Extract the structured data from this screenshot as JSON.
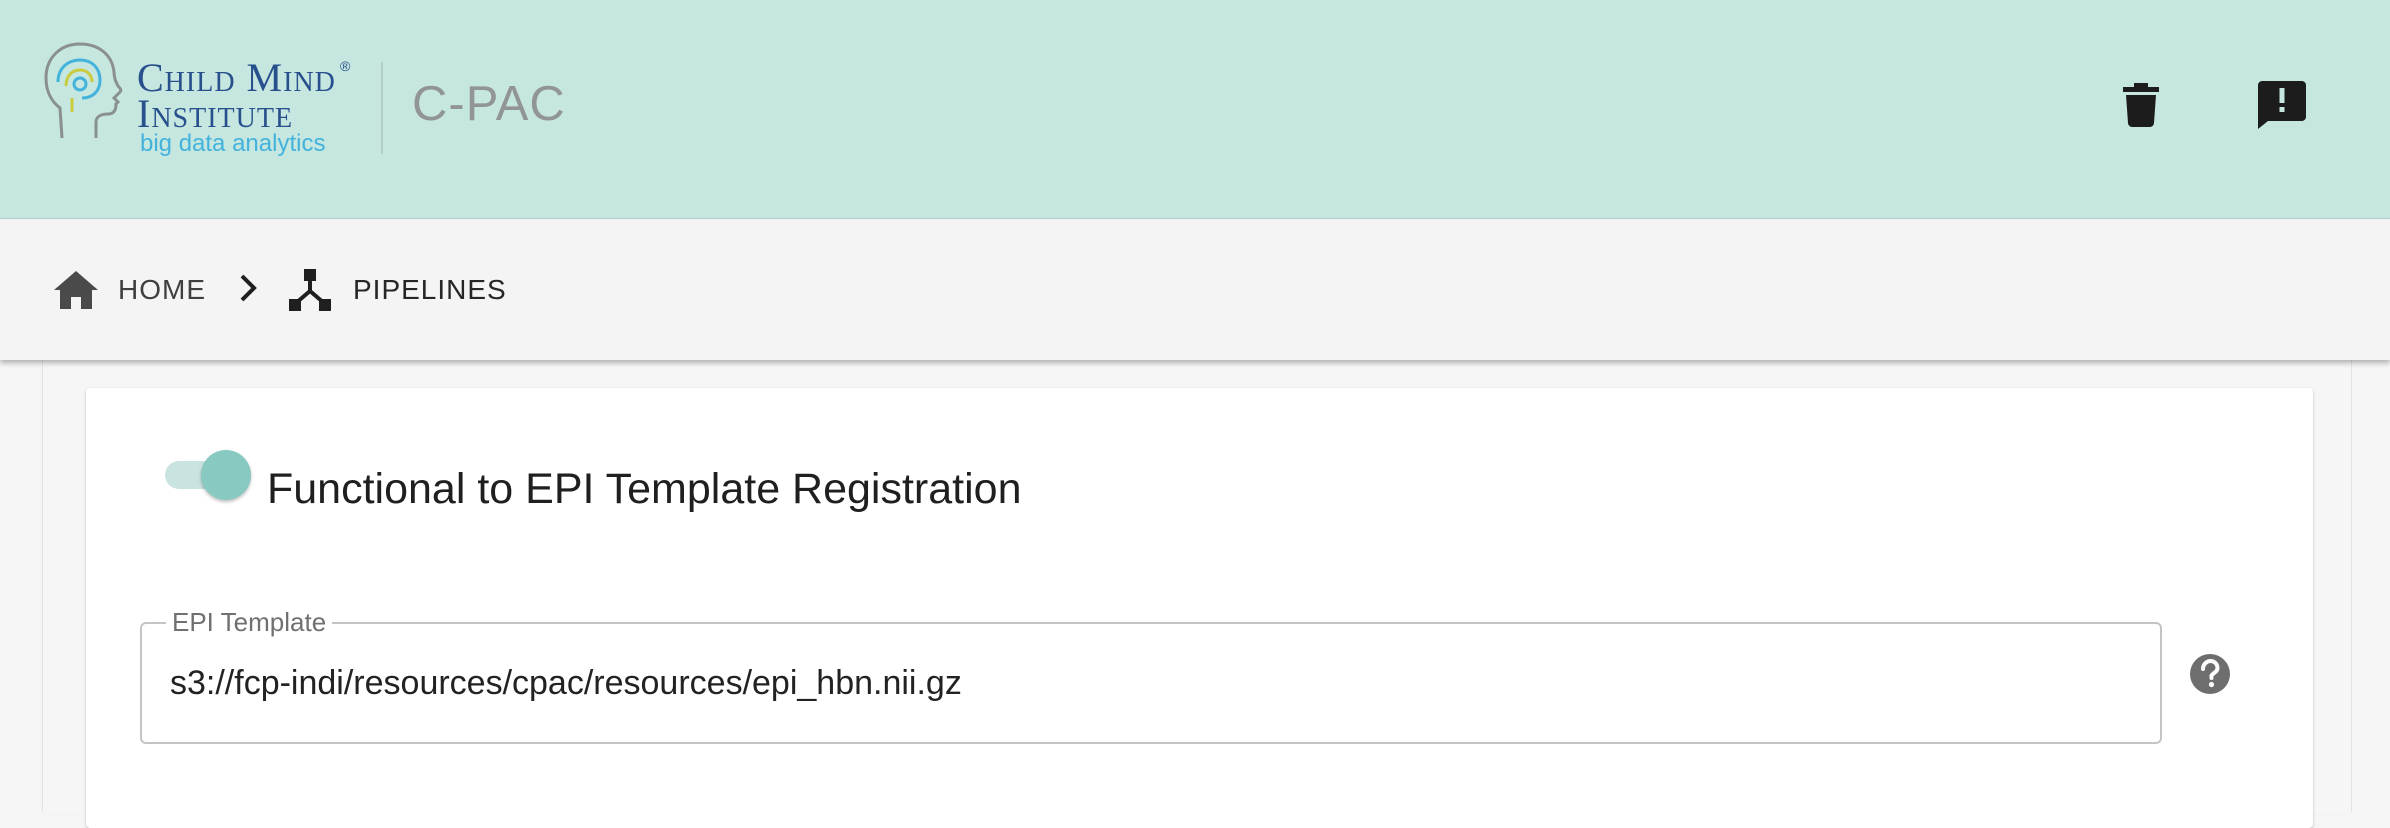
{
  "header": {
    "logo": {
      "line1": "Child Mind",
      "registered": "®",
      "line2": "Institute",
      "line3": "big data analytics"
    },
    "app_title": "C-PAC",
    "actions": [
      {
        "icon": "trash-icon",
        "label": "Delete"
      },
      {
        "icon": "feedback-icon",
        "label": "Feedback"
      }
    ],
    "colors": {
      "background": "#c6e6e0",
      "logo_blue": "#27508c",
      "logo_cyan": "#43b3dc",
      "title_gray": "#929595"
    }
  },
  "breadcrumb": {
    "items": [
      {
        "label": "HOME",
        "icon": "home-icon"
      },
      {
        "label": "PIPELINES",
        "icon": "pipeline-icon"
      }
    ],
    "separator_icon": "chevron-right-icon"
  },
  "card": {
    "toggle": {
      "label": "Functional to EPI Template Registration",
      "checked": true,
      "accent": "#88c9c1"
    },
    "epi_template": {
      "label": "EPI Template",
      "value": "s3://fcp-indi/resources/cpac/resources/epi_hbn.nii.gz",
      "help_icon": "help-icon"
    }
  }
}
